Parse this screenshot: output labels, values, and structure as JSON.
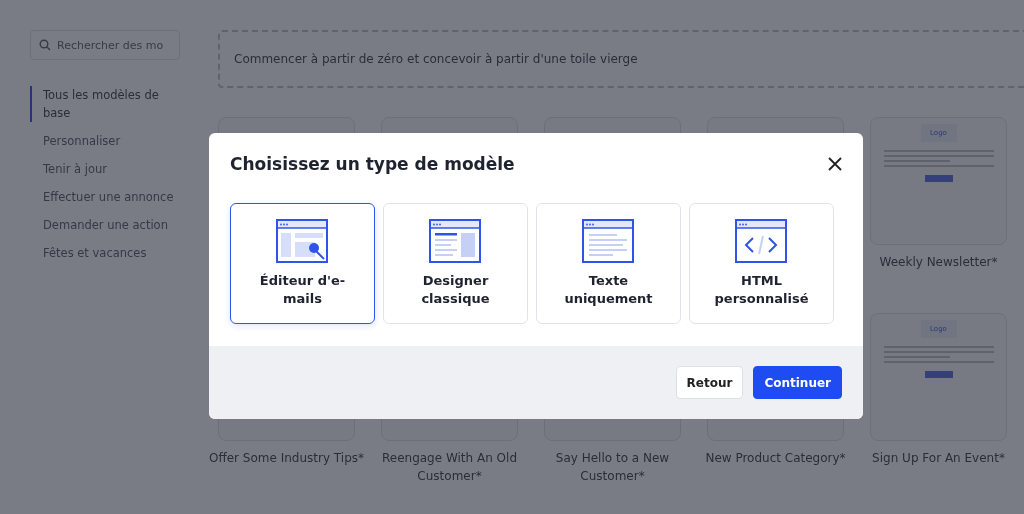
{
  "sidebar": {
    "search": {
      "placeholder": "Rechercher des mo"
    },
    "items": [
      {
        "label": "Tous les modèles de base",
        "selected": true
      },
      {
        "label": "Personnaliser",
        "selected": false
      },
      {
        "label": "Tenir à jour",
        "selected": false
      },
      {
        "label": "Effectuer une annonce",
        "selected": false
      },
      {
        "label": "Demander une action",
        "selected": false
      },
      {
        "label": "Fêtes et vacances",
        "selected": false
      }
    ]
  },
  "blank_start": {
    "label": "Commencer à partir de zéro et concevoir à partir d'une toile vierge"
  },
  "templates": [
    {
      "kind": "plain"
    },
    {
      "kind": "plain"
    },
    {
      "kind": "plain"
    },
    {
      "kind": "plain"
    },
    {
      "kind": "logo",
      "logo": "Logo",
      "name": "Weekly Newsletter*"
    },
    {
      "kind": "plain",
      "name": "Offer Some Industry Tips*"
    },
    {
      "kind": "plain",
      "name": "Reengage With An Old Customer*"
    },
    {
      "kind": "plain",
      "name": "Say Hello to a New Customer*"
    },
    {
      "kind": "plain",
      "name": "New Product Category*"
    },
    {
      "kind": "logo",
      "logo": "Logo",
      "name": "Sign Up For An Event*"
    }
  ],
  "dialog": {
    "title": "Choisissez un type de modèle",
    "options": [
      {
        "kind": "editor",
        "label": "Éditeur d'e-mails",
        "selected": true
      },
      {
        "kind": "designer",
        "label": "Designer classique",
        "selected": false
      },
      {
        "kind": "text",
        "label": "Texte uniquement",
        "selected": false
      },
      {
        "kind": "html",
        "label": "HTML personnalisé",
        "selected": false
      }
    ],
    "buttons": [
      {
        "kind": "secondary",
        "label": "Retour"
      },
      {
        "kind": "primary",
        "label": "Continuer"
      }
    ]
  }
}
